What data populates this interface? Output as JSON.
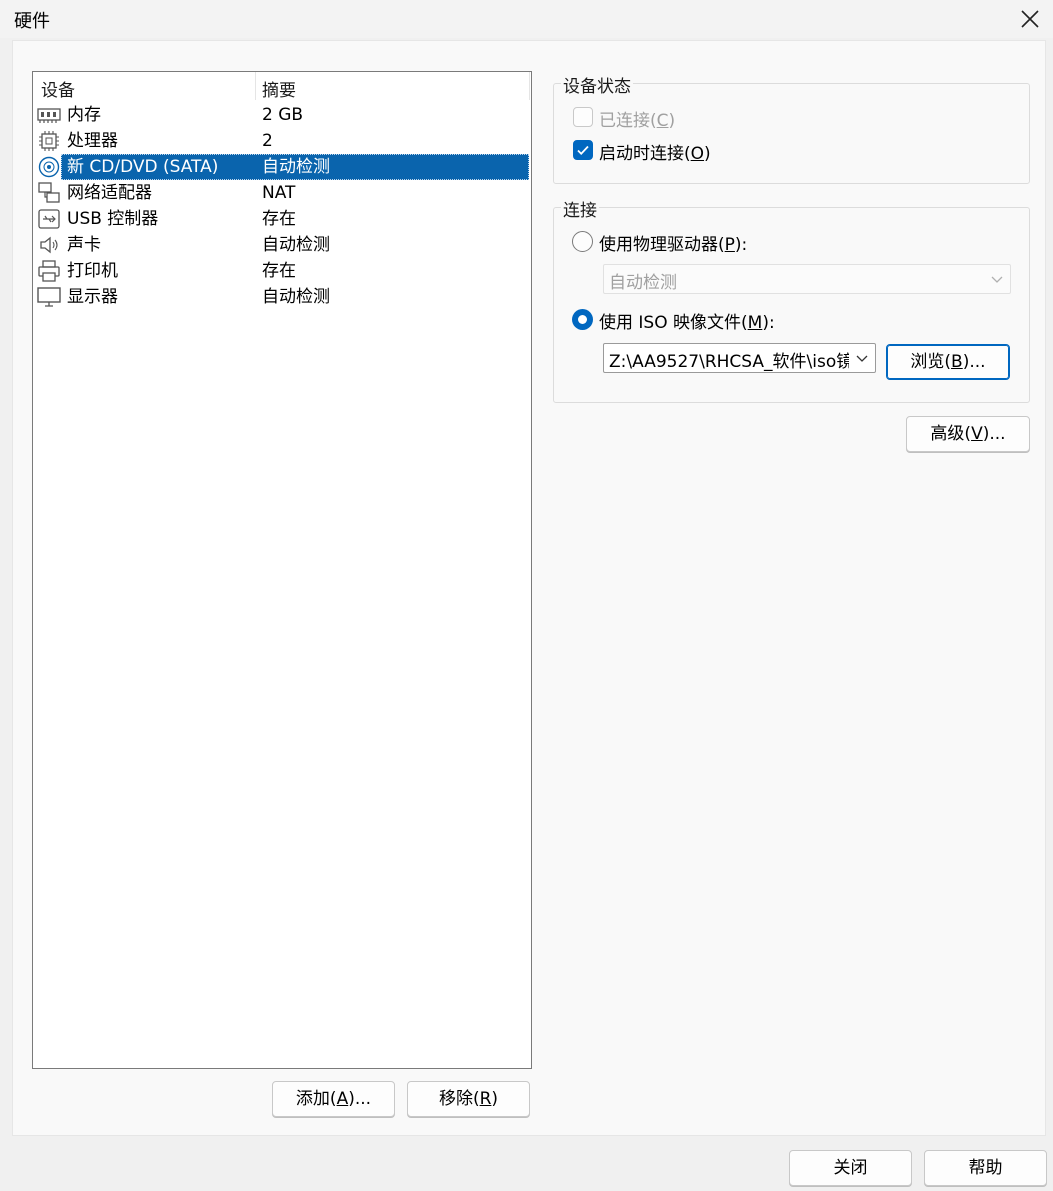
{
  "window": {
    "title": "硬件"
  },
  "device_list": {
    "columns": [
      "设备",
      "摘要"
    ],
    "items": [
      {
        "name": "内存",
        "summary": "2 GB",
        "icon": "memory-icon"
      },
      {
        "name": "处理器",
        "summary": "2",
        "icon": "cpu-icon"
      },
      {
        "name": "新 CD/DVD (SATA)",
        "summary": "自动检测",
        "icon": "cd-icon",
        "selected": true
      },
      {
        "name": "网络适配器",
        "summary": "NAT",
        "icon": "network-icon"
      },
      {
        "name": "USB 控制器",
        "summary": "存在",
        "icon": "usb-icon"
      },
      {
        "name": "声卡",
        "summary": "自动检测",
        "icon": "speaker-icon"
      },
      {
        "name": "打印机",
        "summary": "存在",
        "icon": "printer-icon"
      },
      {
        "name": "显示器",
        "summary": "自动检测",
        "icon": "monitor-icon"
      }
    ]
  },
  "list_buttons": {
    "add": {
      "label": "添加",
      "key": "A",
      "suffix": "..."
    },
    "remove": {
      "label": "移除",
      "key": "R",
      "suffix": ""
    }
  },
  "device_status": {
    "title": "设备状态",
    "connected": {
      "label": "已连接",
      "key": "C",
      "checked": false,
      "disabled": true
    },
    "connect_at_power_on": {
      "label": "启动时连接",
      "key": "O",
      "checked": true
    }
  },
  "connection": {
    "title": "连接",
    "physical": {
      "label": "使用物理驱动器",
      "key": "P",
      "selected": false,
      "dropdown_value": "自动检测"
    },
    "iso": {
      "label": "使用 ISO 映像文件",
      "key": "M",
      "selected": true,
      "path": "Z:\\AA9527\\RHCSA_软件\\iso镜"
    },
    "browse": {
      "label": "浏览",
      "key": "B",
      "suffix": "..."
    }
  },
  "advanced": {
    "label": "高级",
    "key": "V",
    "suffix": "..."
  },
  "footer": {
    "close": "关闭",
    "help": "帮助"
  },
  "colors": {
    "accent": "#0067c0",
    "selection": "#0a64ad"
  }
}
